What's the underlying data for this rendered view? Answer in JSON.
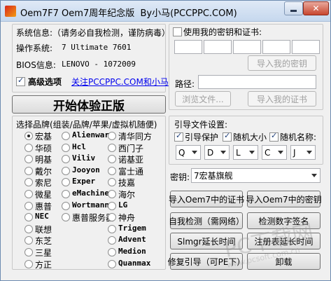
{
  "window": {
    "title": "Oem7F7 Oem7周年纪念版",
    "title_author": "By小马(PCCPPC.COM)"
  },
  "sysinfo": {
    "heading": "系统信息:（请务必自我检测，谨防病毒）",
    "os_label": "操作系统:",
    "os_value": "7 Ultimate 7601",
    "bios_label": "BIOS信息:",
    "bios_value": "LENOVO - 1072009",
    "advanced_label": "高级选项",
    "advanced_checked": true,
    "link": "关注PCCPPC.COM和小马"
  },
  "start_button": "开始体验正版",
  "brands": {
    "heading": "选择品牌(组装/品牌/苹果/虚拟机随便)",
    "col1": [
      "宏基",
      "华硕",
      "明基",
      "戴尔",
      "索尼",
      "微星",
      "惠普",
      "NEC",
      "联想",
      "东芝",
      "三星",
      "方正"
    ],
    "col2": [
      "Alienware",
      "Hcl",
      "Viliv",
      "Jooyon",
      "Exper",
      "eMachine",
      "Wortmann",
      "惠普服务器"
    ],
    "col3": [
      "清华同方",
      "西门子",
      "诺基亚",
      "富士通",
      "技嘉",
      "海尔",
      "LG",
      "神舟",
      "Trigem",
      "Advent",
      "Medion",
      "Quanmax"
    ],
    "selected": "宏基"
  },
  "keycert": {
    "use_label": "使用我的密钥和证书:",
    "use_checked": false,
    "import_key": "导入我的密钥",
    "path_label": "路径:",
    "browse": "浏览文件...",
    "import_cert": "导入我的证书"
  },
  "boot": {
    "heading": "引导文件设置:",
    "protect": "引导保护",
    "random_size": "随机大小",
    "random_name": "随机名称:",
    "protect_checked": true,
    "random_size_checked": true,
    "random_name_checked": true,
    "drives": [
      "Q",
      "D",
      "L",
      "C",
      "J"
    ]
  },
  "key_row": {
    "label": "密钥:",
    "value": "7宏基旗舰"
  },
  "actions": {
    "import_oem_cert": "导入Oem7中的证书",
    "import_oem_key": "导入Oem7中的密钥",
    "self_check": "自我检测（需网络）",
    "check_digest": "检测数字签名",
    "slmgr": "Slmgr延长时间",
    "register": "注册表延长时间",
    "repair": "修复引导（可PE下）",
    "uninstall": "卸载"
  },
  "watermark": {
    "line1": "PC下载网",
    "line2": "www.pcsoft.com.cn"
  },
  "colors": {
    "title_bar": "#c6d8ee",
    "close_button": "#c8462f",
    "link": "#0000ee"
  }
}
